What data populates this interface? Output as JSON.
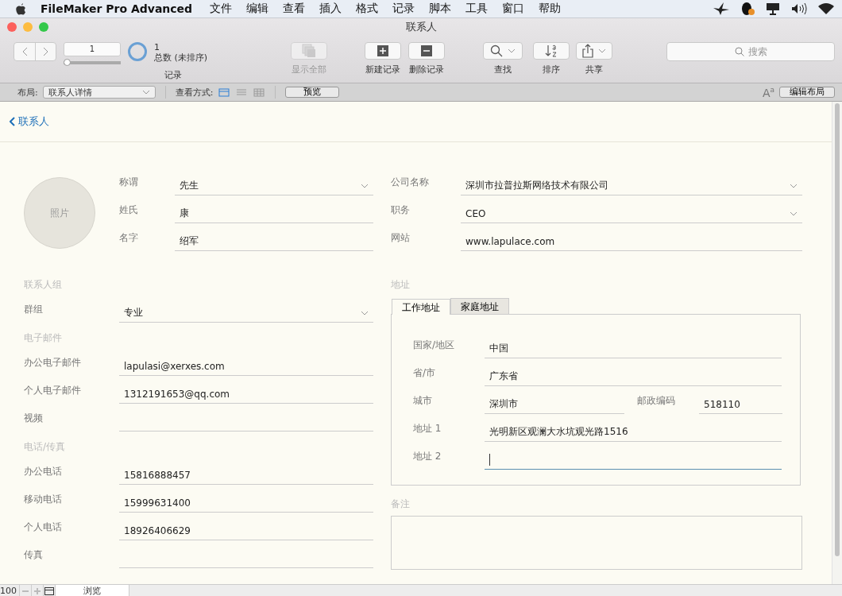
{
  "menubar": {
    "app_name": "FileMaker Pro Advanced",
    "menus": [
      "文件",
      "编辑",
      "查看",
      "插入",
      "格式",
      "记录",
      "脚本",
      "工具",
      "窗口",
      "帮助"
    ]
  },
  "window": {
    "title": "联系人"
  },
  "toolbar": {
    "record_number": "1",
    "record_slider": {
      "level": 0
    },
    "record_count": "1",
    "record_status": "总数 (未排序)",
    "records_label": "记录",
    "search": {
      "placeholder": "搜索"
    },
    "buttons": [
      {
        "kind": "show_all",
        "label": "显示全部",
        "disabled": true
      },
      {
        "kind": "new",
        "label": "新建记录",
        "disabled": false
      },
      {
        "kind": "delete",
        "label": "删除记录",
        "disabled": false
      },
      {
        "kind": "find",
        "label": "查找",
        "disabled": false
      },
      {
        "kind": "sort",
        "label": "排序",
        "disabled": false
      },
      {
        "kind": "share",
        "label": "共享",
        "disabled": false
      }
    ]
  },
  "layout_bar": {
    "layout_label": "布局:",
    "layout_value": "联系人详情",
    "view_label": "查看方式:",
    "view_modes": [
      {
        "kind": "form",
        "selected": true
      },
      {
        "kind": "list",
        "selected": false
      },
      {
        "kind": "table",
        "selected": false
      }
    ],
    "preview_button": "预览",
    "text_size_button": "A$^{a}$",
    "edit_layout_button": "编辑布局"
  },
  "header": {
    "back_link": "联系人"
  },
  "photo": {
    "label": "照片"
  },
  "name_fields": [
    {
      "label": "称谓",
      "value": "先生",
      "kind": "dropdown"
    },
    {
      "label": "姓氏",
      "value": "康",
      "kind": "text"
    },
    {
      "label": "名字",
      "value": "绍军",
      "kind": "text"
    }
  ],
  "company_fields": [
    {
      "label": "公司名称",
      "value": "深圳市拉普拉斯网络技术有限公司",
      "kind": "dropdown"
    },
    {
      "label": "职务",
      "value": "CEO",
      "kind": "dropdown"
    },
    {
      "label": "网站",
      "value": "www.lapulace.com",
      "kind": "text"
    }
  ],
  "sections": [
    {
      "title": "联系人组",
      "fields": [
        {
          "label": "群组",
          "value": "专业",
          "kind": "dropdown"
        }
      ]
    },
    {
      "title": "电子邮件",
      "fields": [
        {
          "label": "办公电子邮件",
          "value": "lapulasi@xerxes.com",
          "kind": "text"
        },
        {
          "label": "个人电子邮件",
          "value": "1312191653@qq.com",
          "kind": "text"
        },
        {
          "label": "视频",
          "kind": "text"
        }
      ]
    },
    {
      "title": "电话/传真",
      "fields": [
        {
          "label": "办公电话",
          "value": "15816888457",
          "kind": "text"
        },
        {
          "label": "移动电话",
          "value": "15999631400",
          "kind": "text"
        },
        {
          "label": "个人电话",
          "value": "18926406629",
          "kind": "text"
        },
        {
          "label": "传真",
          "kind": "text"
        }
      ]
    }
  ],
  "address": {
    "title": "地址",
    "tabs": [
      {
        "label": "工作地址",
        "selected": true
      },
      {
        "label": "家庭地址",
        "selected": false
      }
    ],
    "rows": [
      [
        {
          "label": "国家/地区",
          "value": "中国",
          "focused": false
        }
      ],
      [
        {
          "label": "省/市",
          "value": "广东省",
          "focused": false
        }
      ],
      [
        {
          "label": "城市",
          "value": "深圳市",
          "focused": false
        },
        {
          "label": "邮政编码",
          "value": "518110",
          "focused": false
        }
      ],
      [
        {
          "label": "地址 1",
          "value": "光明新区观澜大水坑观光路1516",
          "focused": false
        }
      ],
      [
        {
          "label": "地址 2",
          "focused": true
        }
      ]
    ]
  },
  "notes": {
    "label": "备注"
  },
  "status_bar": {
    "zoom": "100",
    "mode": "浏览"
  }
}
